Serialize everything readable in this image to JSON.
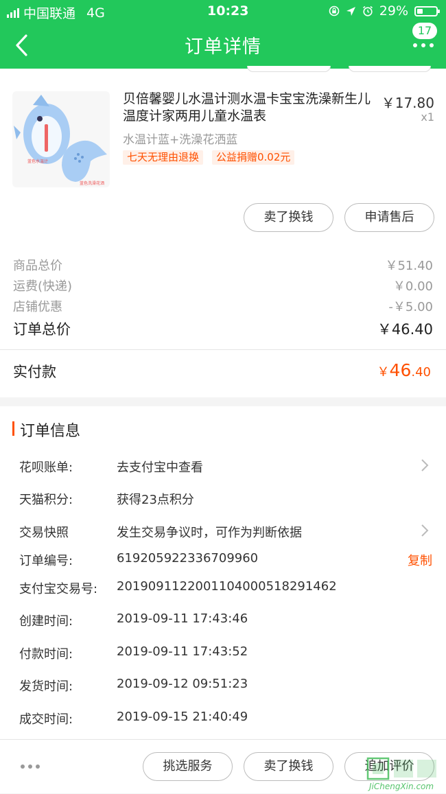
{
  "status_bar": {
    "carrier": "中国联通",
    "network": "4G",
    "time": "10:23",
    "battery": "29%"
  },
  "nav": {
    "title": "订单详情",
    "message_count": "17"
  },
  "product": {
    "name": "贝倍馨婴儿水温计测水温卡宝宝洗澡新生儿温度计家两用儿童水温表",
    "price": "￥17.80",
    "quantity": "x1",
    "sku": "水温计蓝+洗澡花洒蓝",
    "tags": [
      "七天无理由退换",
      "公益捐赠0.02元"
    ],
    "thumb_captions": [
      "蓝色水温计",
      "蓝色洗澡花洒"
    ],
    "actions": [
      "卖了换钱",
      "申请售后"
    ]
  },
  "fees": [
    {
      "label": "商品总价",
      "value": "￥51.40"
    },
    {
      "label": "运费(快递)",
      "value": "￥0.00"
    },
    {
      "label": "店铺优惠",
      "value": "-￥5.00"
    }
  ],
  "order_total": {
    "label": "订单总价",
    "value": "￥46.40"
  },
  "paid": {
    "label": "实付款",
    "symbol": "￥",
    "int": "46",
    "dec": ".40"
  },
  "order_info": {
    "title": "订单信息",
    "rows": [
      {
        "label": "花呗账单:",
        "value": "去支付宝中查看"
      },
      {
        "label": "天猫积分:",
        "value": "获得23点积分"
      },
      {
        "label": "交易快照",
        "value": "发生交易争议时，可作为判断依据"
      },
      {
        "label": "订单编号:",
        "value": "619205922336709960"
      },
      {
        "label": "支付宝交易号:",
        "value": "2019091122001104000518291462"
      },
      {
        "label": "创建时间:",
        "value": "2019-09-11 17:43:46"
      },
      {
        "label": "付款时间:",
        "value": "2019-09-11 17:43:52"
      },
      {
        "label": "发货时间:",
        "value": "2019-09-12 09:51:23"
      },
      {
        "label": "成交时间:",
        "value": "2019-09-15 21:40:49"
      }
    ],
    "copy_label": "复制"
  },
  "bottom_actions": [
    "挑选服务",
    "卖了换钱",
    "追加评价"
  ],
  "watermark": {
    "text": "JiChengXin.com"
  },
  "colors": {
    "brand_green": "#22c85b",
    "accent_orange": "#ff5000"
  }
}
